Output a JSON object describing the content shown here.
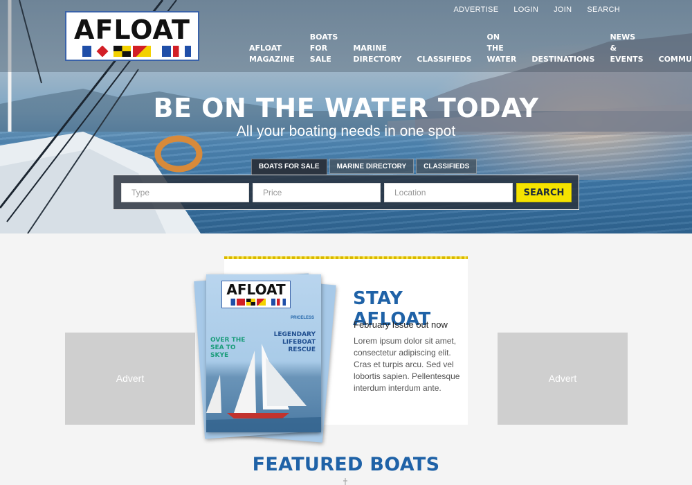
{
  "brand": {
    "logo_text": "AFLOAT"
  },
  "utility_nav": [
    "ADVERTISE",
    "LOGIN",
    "JOIN",
    "SEARCH"
  ],
  "main_nav": [
    "AFLOAT\nMAGAZINE",
    "BOATS\nFOR SALE",
    "MARINE\nDIRECTORY",
    "CLASSIFIEDS",
    "ON THE\nWATER",
    "DESTINATIONS",
    "NEWS &\nEVENTS",
    "COMMUNITY"
  ],
  "hero": {
    "title": "BE ON THE WATER TODAY",
    "subtitle": "All your boating needs in one spot"
  },
  "search": {
    "tabs": [
      {
        "label": "BOATS FOR SALE",
        "active": true
      },
      {
        "label": "MARINE DIRECTORY",
        "active": false
      },
      {
        "label": "CLASSIFIEDS",
        "active": false
      }
    ],
    "type_placeholder": "Type",
    "price_placeholder": "Price",
    "location_placeholder": "Location",
    "button_label": "SEARCH"
  },
  "adverts": {
    "left_label": "Advert",
    "right_label": "Advert"
  },
  "promo": {
    "title": "STAY AFLOAT",
    "issue": "February Issue out now",
    "body": "Lorem ipsum dolor sit amet, consectetur adipiscing elit. Cras et turpis arcu. Sed vel lobortis sapien. Pellentesque interdum interdum ante."
  },
  "magazine_cover": {
    "logo_text": "AFLOAT",
    "priceless": "PRICELESS",
    "headline_left": "OVER THE SEA TO SKYE",
    "headline_right": "LEGENDARY LIFEBOAT RESCUE"
  },
  "featured": {
    "title": "FEATURED BOATS"
  },
  "colors": {
    "accent_blue": "#1f62a7",
    "search_yellow": "#f5e300",
    "advert_grey": "#cfcfcf"
  }
}
